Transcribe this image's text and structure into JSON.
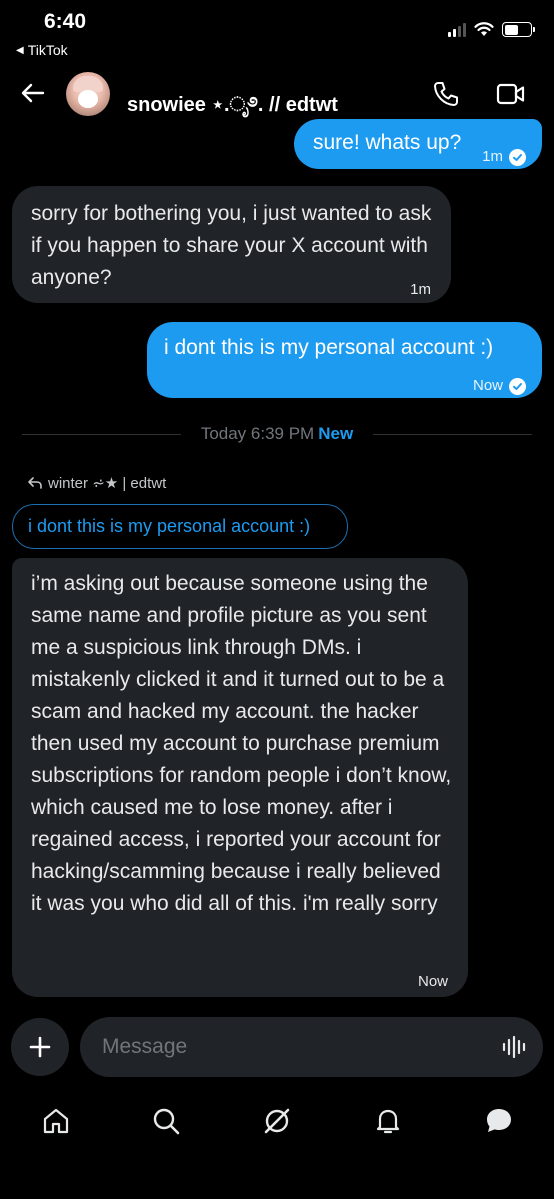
{
  "status_bar": {
    "time": "6:40",
    "back_app": "TikTok"
  },
  "header": {
    "name": "snowiee ⋆.ೃ࿔. // edtwt"
  },
  "messages": [
    {
      "direction": "out",
      "text": "sure! whats up?",
      "time": "1m"
    },
    {
      "direction": "in",
      "text": "sorry for bothering you, i just wanted to ask if you happen to share your X account with anyone?",
      "time": "1m"
    },
    {
      "direction": "out",
      "text": "i dont this is my personal account :)",
      "time": "Now"
    },
    {
      "direction": "in",
      "text": "i’m asking out because someone using the same name and profile picture as you sent me a suspicious link through DMs. i mistakenly clicked it and it turned out to be a scam and hacked my account. the hacker then used my account to purchase premium subscriptions for random people i don’t know, which caused me to lose money. after i regained access, i reported your account for hacking/scamming because i really believed it was you who did all of this. i'm really sorry",
      "time": "Now"
    }
  ],
  "divider": {
    "label": "Today 6:39 PM",
    "new_label": "New"
  },
  "reply": {
    "to": "winter ⩫★ | edtwt",
    "quoted": "i dont this is my personal account :)"
  },
  "composer": {
    "placeholder": "Message"
  },
  "nav": [
    "home-icon",
    "search-icon",
    "grok-icon",
    "notifications-icon",
    "messages-icon"
  ],
  "colors": {
    "accent": "#1d9bf0",
    "incoming_bubble": "#202327",
    "background": "#000000"
  }
}
